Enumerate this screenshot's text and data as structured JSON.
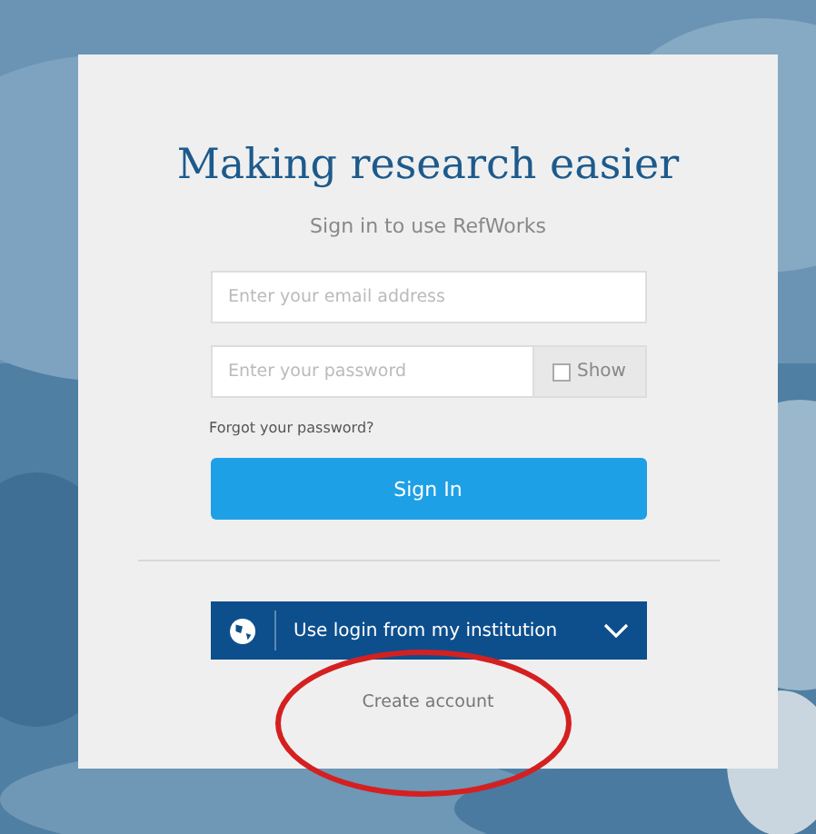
{
  "title": "Making research easier",
  "subtitle": "Sign in to use RefWorks",
  "email": {
    "placeholder": "Enter your email address"
  },
  "password": {
    "placeholder": "Enter your password"
  },
  "show_password": {
    "label": "Show",
    "checked": false
  },
  "forgot_link": "Forgot your password?",
  "sign_in_button": "Sign In",
  "institution_button": "Use login from my institution",
  "create_account_link": "Create account"
}
